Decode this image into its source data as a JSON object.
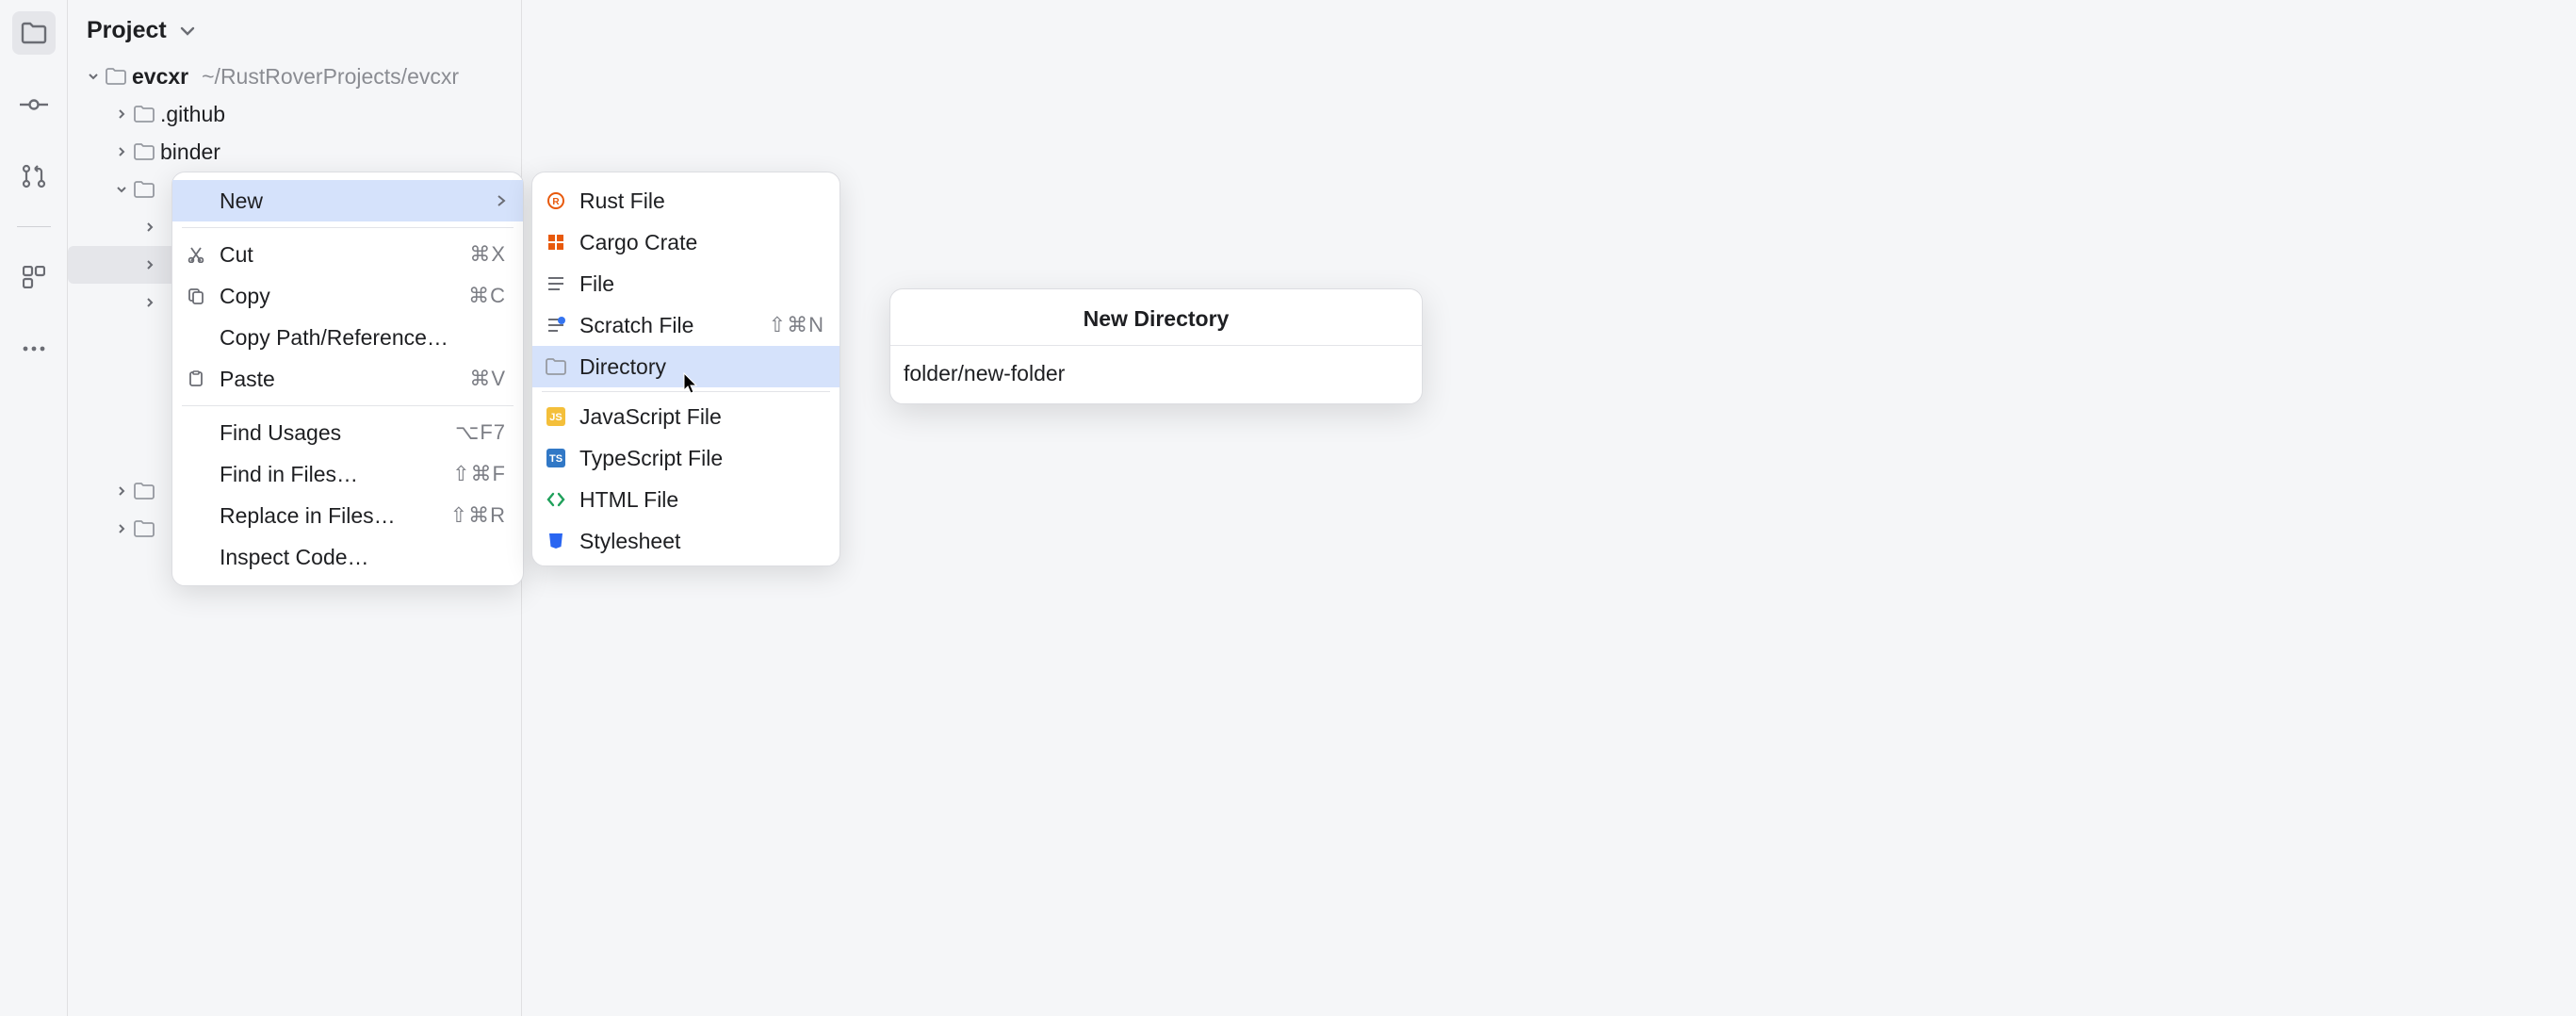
{
  "panel_title": "Project",
  "tree": {
    "root": {
      "name": "evcxr",
      "path": "~/RustRoverProjects/evcxr"
    },
    "children": [
      {
        "name": ".github"
      },
      {
        "name": "binder"
      }
    ]
  },
  "context_menu": [
    {
      "label": "New",
      "highlight": true,
      "submenu": true
    },
    {
      "label": "Cut",
      "shortcut": "⌘X",
      "icon": "cut"
    },
    {
      "label": "Copy",
      "shortcut": "⌘C",
      "icon": "copy"
    },
    {
      "label": "Copy Path/Reference…"
    },
    {
      "label": "Paste",
      "shortcut": "⌘V",
      "icon": "paste"
    },
    {
      "sep": true
    },
    {
      "label": "Find Usages",
      "shortcut": "⌥F7"
    },
    {
      "label": "Find in Files…",
      "shortcut": "⇧⌘F"
    },
    {
      "label": "Replace in Files…",
      "shortcut": "⇧⌘R"
    },
    {
      "label": "Inspect Code…"
    }
  ],
  "submenu": [
    {
      "label": "Rust File",
      "icon": "rust"
    },
    {
      "label": "Cargo Crate",
      "icon": "crate"
    },
    {
      "label": "File",
      "icon": "file"
    },
    {
      "label": "Scratch File",
      "icon": "scratch",
      "shortcut": "⇧⌘N"
    },
    {
      "label": "Directory",
      "icon": "folder",
      "highlight": true
    },
    {
      "sep": true
    },
    {
      "label": "JavaScript File",
      "icon": "js"
    },
    {
      "label": "TypeScript File",
      "icon": "ts"
    },
    {
      "label": "HTML File",
      "icon": "html"
    },
    {
      "label": "Stylesheet",
      "icon": "css"
    }
  ],
  "popup": {
    "title": "New Directory",
    "value": "folder/new-folder"
  }
}
